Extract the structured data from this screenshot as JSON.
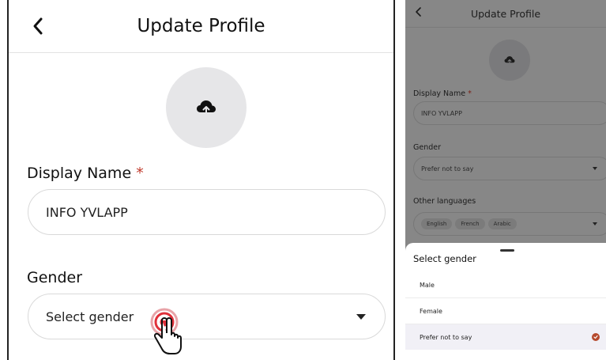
{
  "left": {
    "title": "Update Profile",
    "display_name_label": "Display Name",
    "required_mark": "*",
    "display_name_value": "INFO YVLAPP",
    "gender_label": "Gender",
    "gender_placeholder": "Select gender"
  },
  "right": {
    "title": "Update Profile",
    "display_name_label": "Display Name",
    "required_mark": "*",
    "display_name_value": "INFO YVLAPP",
    "gender_label": "Gender",
    "gender_value": "Prefer not to say",
    "languages_label": "Other languages",
    "languages": [
      "English",
      "French",
      "Arabic"
    ],
    "sheet": {
      "title": "Select gender",
      "options": [
        "Male",
        "Female",
        "Prefer not to say"
      ],
      "selected": "Prefer not to say"
    }
  },
  "icons": {
    "back": "chevron-left-icon",
    "upload": "cloud-upload-icon",
    "dropdown": "caret-down-icon",
    "tap": "tap-hand-icon",
    "check": "check-circle-icon"
  },
  "colors": {
    "required": "#c0392b",
    "selected_check": "#b64a2e",
    "avatar_bg": "#e6e6e8",
    "overlay": "#878787"
  }
}
